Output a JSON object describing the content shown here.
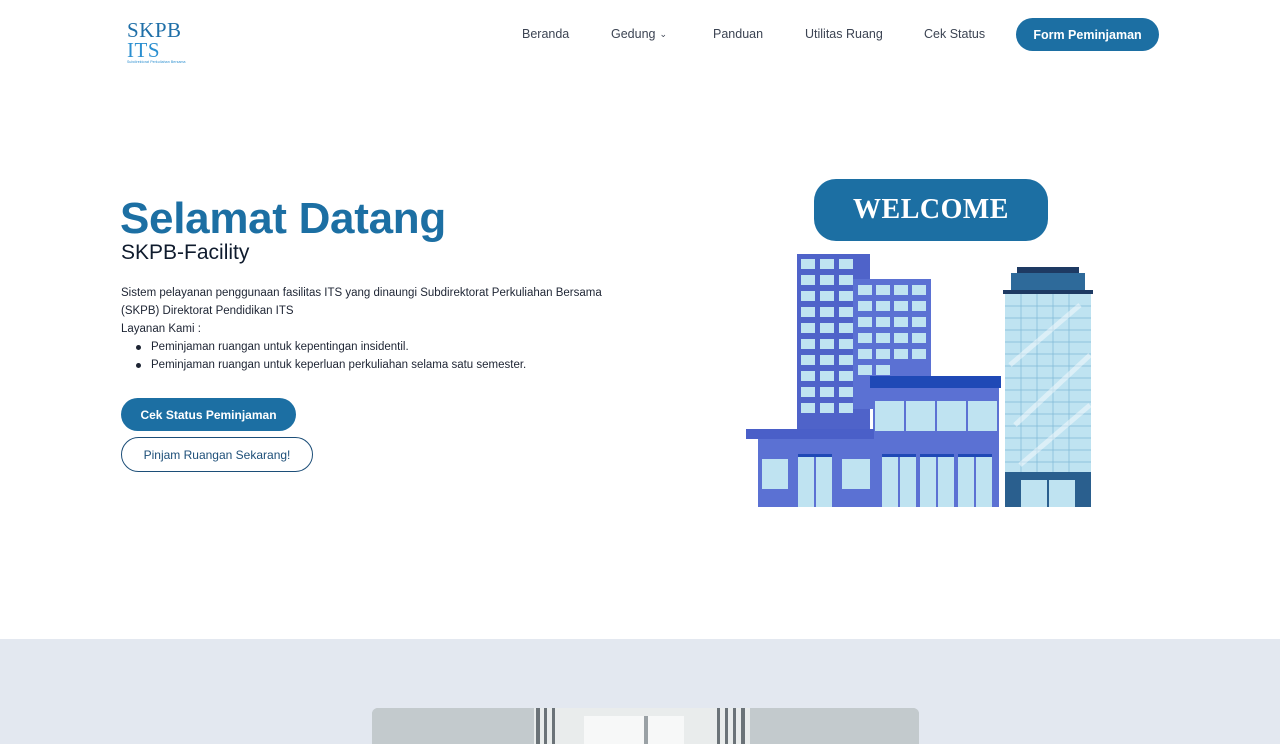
{
  "nav": {
    "logo_text": "SKPB",
    "logo_its": "ITS",
    "logo_subtitle": "Subdirektorat Perkuliahan Bersama",
    "links": [
      "Beranda",
      "Gedung",
      "Panduan",
      "Utilitas Ruang",
      "Cek Status"
    ],
    "cta_label": "Form Peminjaman"
  },
  "hero": {
    "title": "Selamat Datang",
    "subtitle": "SKPB-Facility",
    "description": "Sistem pelayanan penggunaan fasilitas ITS yang dinaungi Subdirektorat Perkuliahan Bersama (SKPB) Direktorat Pendidikan ITS",
    "services_label": "Layanan Kami :",
    "services": [
      "Peminjaman ruangan untuk kepentingan insidentil.",
      "Peminjaman ruangan untuk keperluan perkuliahan selama satu semester."
    ],
    "primary_button": "Cek Status Peminjaman",
    "secondary_button": "Pinjam Ruangan Sekarang!"
  },
  "illustration": {
    "welcome_text": "WELCOME"
  },
  "colors": {
    "primary": "#1c6fa3",
    "section_bg": "#e3e8f0",
    "building_blue": "#4f63c9",
    "glass": "#bfe3f1"
  }
}
